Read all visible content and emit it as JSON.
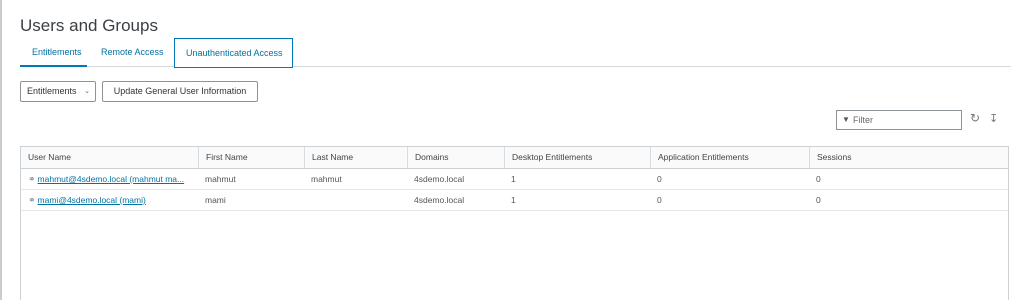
{
  "page_title": "Users and Groups",
  "tabs": [
    {
      "label": "Entitlements",
      "active": true
    },
    {
      "label": "Remote Access",
      "active": false
    },
    {
      "label": "Unauthenticated Access",
      "active": false
    }
  ],
  "toolbar": {
    "dropdown_label": "Entitlements",
    "dropdown_chevron": "⌄",
    "update_label": "Update General User Information"
  },
  "filter": {
    "placeholder": "Filter",
    "icon": "funnel-icon"
  },
  "actions": {
    "refresh_icon": "refresh-icon",
    "download_icon": "download-icon"
  },
  "grid": {
    "columns": [
      "User Name",
      "First Name",
      "Last Name",
      "Domains",
      "Desktop Entitlements",
      "Application Entitlements",
      "Sessions"
    ],
    "rows": [
      {
        "user": "mahmut@4sdemo.local (mahmut ma...",
        "first": "mahmut",
        "last": "mahmut",
        "domain": "4sdemo.local",
        "desktop": "1",
        "application": "0",
        "sessions": "0"
      },
      {
        "user": "mami@4sdemo.local (mami)",
        "first": "mami",
        "last": "",
        "domain": "4sdemo.local",
        "desktop": "1",
        "application": "0",
        "sessions": "0"
      }
    ]
  },
  "colors": {
    "accent": "#0079b8",
    "link": "#0072a3",
    "border": "#ccd1d5"
  }
}
